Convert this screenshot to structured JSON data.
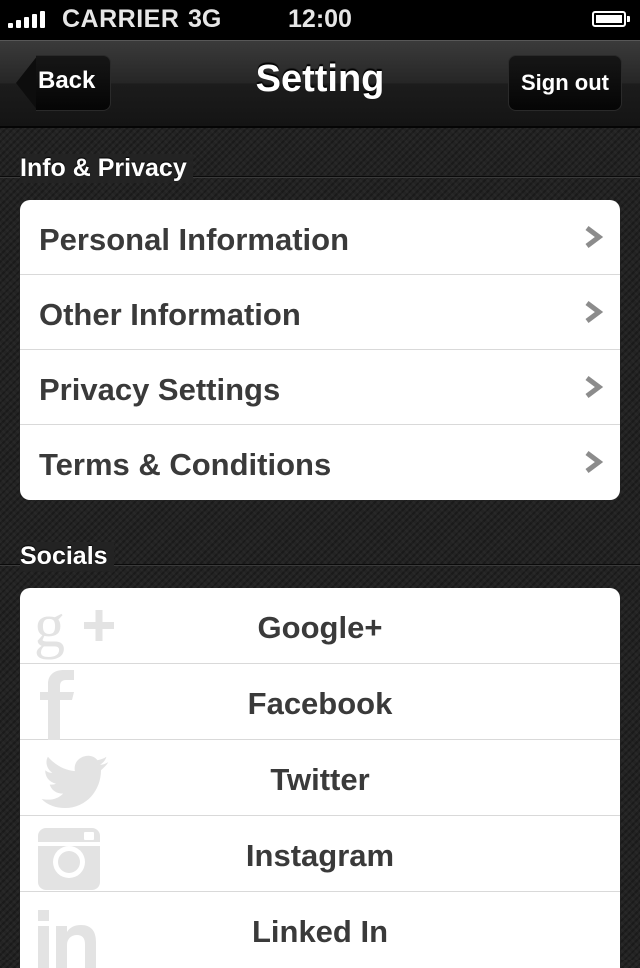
{
  "status_bar": {
    "carrier": "CARRIER",
    "network": "3G",
    "time": "12:00"
  },
  "nav": {
    "back_label": "Back",
    "title": "Setting",
    "sign_out_label": "Sign out"
  },
  "info_section": {
    "title": "Info & Privacy",
    "items": [
      {
        "label": "Personal Information"
      },
      {
        "label": "Other Information"
      },
      {
        "label": "Privacy Settings"
      },
      {
        "label": "Terms & Conditions"
      }
    ]
  },
  "socials_section": {
    "title": "Socials",
    "items": [
      {
        "label": "Google+",
        "icon": "google-plus-icon"
      },
      {
        "label": "Facebook",
        "icon": "facebook-icon"
      },
      {
        "label": "Twitter",
        "icon": "twitter-icon"
      },
      {
        "label": "Instagram",
        "icon": "instagram-icon"
      },
      {
        "label": "Linked In",
        "icon": "linkedin-icon"
      }
    ]
  }
}
